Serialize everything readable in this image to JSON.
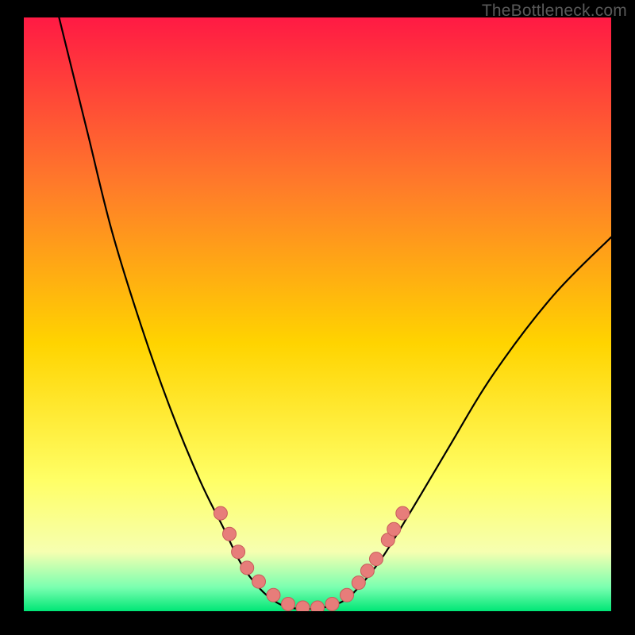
{
  "watermark": "TheBottleneck.com",
  "colors": {
    "grad_top": "#ff1a44",
    "grad_mid1": "#ff7a2a",
    "grad_mid2": "#ffd400",
    "grad_mid3": "#ffff66",
    "grad_mid4": "#f6ffb0",
    "grad_bot1": "#7affb0",
    "grad_bot2": "#00e676",
    "curve": "#000000",
    "dot_fill": "#e77d7a",
    "dot_stroke": "#c85c5a"
  },
  "chart_data": {
    "type": "line",
    "title": "",
    "xlabel": "",
    "ylabel": "",
    "xlim": [
      0,
      100
    ],
    "ylim": [
      0,
      100
    ],
    "legend": false,
    "curve": [
      {
        "x": 6,
        "y": 100
      },
      {
        "x": 8,
        "y": 92
      },
      {
        "x": 11,
        "y": 80
      },
      {
        "x": 15,
        "y": 64
      },
      {
        "x": 20,
        "y": 48
      },
      {
        "x": 25,
        "y": 34
      },
      {
        "x": 30,
        "y": 22
      },
      {
        "x": 34,
        "y": 14
      },
      {
        "x": 37,
        "y": 8
      },
      {
        "x": 40,
        "y": 4
      },
      {
        "x": 43,
        "y": 1.5
      },
      {
        "x": 46,
        "y": 0.5
      },
      {
        "x": 50,
        "y": 0.5
      },
      {
        "x": 54,
        "y": 1.5
      },
      {
        "x": 57,
        "y": 4
      },
      {
        "x": 61,
        "y": 9
      },
      {
        "x": 66,
        "y": 17
      },
      {
        "x": 72,
        "y": 27
      },
      {
        "x": 80,
        "y": 40
      },
      {
        "x": 90,
        "y": 53
      },
      {
        "x": 100,
        "y": 63
      }
    ],
    "dots": [
      {
        "x": 33.5,
        "y": 16.5
      },
      {
        "x": 35.0,
        "y": 13.0
      },
      {
        "x": 36.5,
        "y": 10.0
      },
      {
        "x": 38.0,
        "y": 7.3
      },
      {
        "x": 40.0,
        "y": 5.0
      },
      {
        "x": 42.5,
        "y": 2.7
      },
      {
        "x": 45.0,
        "y": 1.2
      },
      {
        "x": 47.5,
        "y": 0.6
      },
      {
        "x": 50.0,
        "y": 0.6
      },
      {
        "x": 52.5,
        "y": 1.2
      },
      {
        "x": 55.0,
        "y": 2.7
      },
      {
        "x": 57.0,
        "y": 4.8
      },
      {
        "x": 58.5,
        "y": 6.8
      },
      {
        "x": 60.0,
        "y": 8.8
      },
      {
        "x": 62.0,
        "y": 12.0
      },
      {
        "x": 63.0,
        "y": 13.8
      },
      {
        "x": 64.5,
        "y": 16.5
      }
    ]
  }
}
